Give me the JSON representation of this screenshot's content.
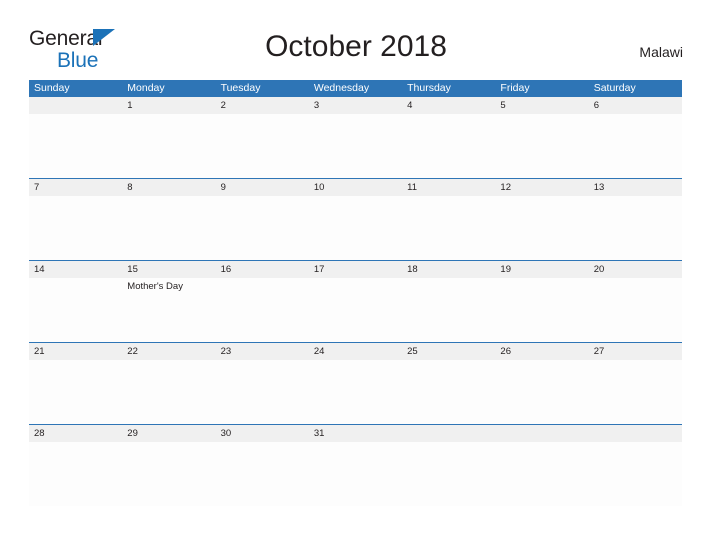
{
  "logo": {
    "text_top": "General",
    "text_bottom": "Blue",
    "triangle_icon": "triangle-icon",
    "color_dark": "#231f20",
    "color_blue": "#1b72b8"
  },
  "header": {
    "title": "October 2018",
    "region": "Malawi"
  },
  "calendar": {
    "header_bg": "#2e75b6",
    "date_band_bg": "#f0f0f0",
    "weekdays": [
      "Sunday",
      "Monday",
      "Tuesday",
      "Wednesday",
      "Thursday",
      "Friday",
      "Saturday"
    ],
    "weeks": [
      {
        "days": [
          {
            "num": "",
            "events": []
          },
          {
            "num": "1",
            "events": []
          },
          {
            "num": "2",
            "events": []
          },
          {
            "num": "3",
            "events": []
          },
          {
            "num": "4",
            "events": []
          },
          {
            "num": "5",
            "events": []
          },
          {
            "num": "6",
            "events": []
          }
        ]
      },
      {
        "days": [
          {
            "num": "7",
            "events": []
          },
          {
            "num": "8",
            "events": []
          },
          {
            "num": "9",
            "events": []
          },
          {
            "num": "10",
            "events": []
          },
          {
            "num": "11",
            "events": []
          },
          {
            "num": "12",
            "events": []
          },
          {
            "num": "13",
            "events": []
          }
        ]
      },
      {
        "days": [
          {
            "num": "14",
            "events": []
          },
          {
            "num": "15",
            "events": [
              "Mother's Day"
            ]
          },
          {
            "num": "16",
            "events": []
          },
          {
            "num": "17",
            "events": []
          },
          {
            "num": "18",
            "events": []
          },
          {
            "num": "19",
            "events": []
          },
          {
            "num": "20",
            "events": []
          }
        ]
      },
      {
        "days": [
          {
            "num": "21",
            "events": []
          },
          {
            "num": "22",
            "events": []
          },
          {
            "num": "23",
            "events": []
          },
          {
            "num": "24",
            "events": []
          },
          {
            "num": "25",
            "events": []
          },
          {
            "num": "26",
            "events": []
          },
          {
            "num": "27",
            "events": []
          }
        ]
      },
      {
        "days": [
          {
            "num": "28",
            "events": []
          },
          {
            "num": "29",
            "events": []
          },
          {
            "num": "30",
            "events": []
          },
          {
            "num": "31",
            "events": []
          },
          {
            "num": "",
            "events": []
          },
          {
            "num": "",
            "events": []
          },
          {
            "num": "",
            "events": []
          }
        ]
      }
    ]
  }
}
